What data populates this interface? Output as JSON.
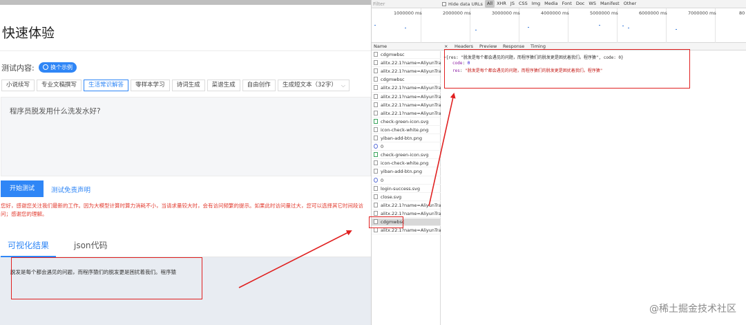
{
  "app": {
    "title": "快速体验",
    "test_label": "测试内容:",
    "example_button": "换个示例",
    "tabs": [
      "小说续写",
      "专业文稿撰写",
      "生活常识解答",
      "零样本学习",
      "诗词生成",
      "菜谱生成",
      "自由创作"
    ],
    "active_tab_index": 2,
    "select_value": "生成短文本（32字）",
    "input_text": "程序员脱发用什么洗发水好?",
    "start_button": "开始测试",
    "disclaimer_link": "测试免责声明",
    "notice": "您好，感谢您关注我们最新的工作。因为大模型计算时算力消耗不小，当请求量较大时，会有访问频繁的提示。如果此时访问量过大，您可以选择其它时间段访问；感谢您的理解。",
    "result_tabs": [
      "可视化结果",
      "json代码"
    ],
    "result_text": "脱发是每个都会遇见的问题，而程序猿们的脱发更是困扰着我们。程序猿"
  },
  "devtools": {
    "filter_placeholder": "Filter",
    "hide_data_urls": "Hide data URLs",
    "types": [
      "All",
      "XHR",
      "JS",
      "CSS",
      "Img",
      "Media",
      "Font",
      "Doc",
      "WS",
      "Manifest",
      "Other"
    ],
    "active_type": "All",
    "timeline_ticks": [
      "1000000 ms",
      "2000000 ms",
      "3000000 ms",
      "4000000 ms",
      "5000000 ms",
      "6000000 ms",
      "7000000 ms",
      "80"
    ],
    "name_header": "Name",
    "requests": [
      {
        "name": "cdgmwbsc",
        "icon": "file"
      },
      {
        "name": "alitx.22.1?name=AliyunTra...",
        "icon": "file"
      },
      {
        "name": "alitx.22.1?name=AliyunTra...",
        "icon": "file"
      },
      {
        "name": "cdgmwbsc",
        "icon": "file"
      },
      {
        "name": "alitx.22.1?name=AliyunTra...",
        "icon": "file"
      },
      {
        "name": "alitx.22.1?name=AliyunTra...",
        "icon": "file"
      },
      {
        "name": "alitx.22.1?name=AliyunTra...",
        "icon": "file"
      },
      {
        "name": "alitx.22.1?name=AliyunTra...",
        "icon": "file"
      },
      {
        "name": "check-green-icon.svg",
        "icon": "check"
      },
      {
        "name": "icon-check-white.png",
        "icon": "file"
      },
      {
        "name": "yiban-add-btn.png",
        "icon": "file"
      },
      {
        "name": "0",
        "icon": "circle"
      },
      {
        "name": "check-green-icon.svg",
        "icon": "check"
      },
      {
        "name": "icon-check-white.png",
        "icon": "file"
      },
      {
        "name": "yiban-add-btn.png",
        "icon": "file"
      },
      {
        "name": "0",
        "icon": "circle"
      },
      {
        "name": "login-success.svg",
        "icon": "arrow"
      },
      {
        "name": "close.svg",
        "icon": "file"
      },
      {
        "name": "alitx.22.1?name=AliyunTra...",
        "icon": "file"
      },
      {
        "name": "alitx.22.1?name=AliyunTra...",
        "icon": "file"
      },
      {
        "name": "cdgmwbsc",
        "icon": "file"
      },
      {
        "name": "alitx.22.1?name=AliyunTra...",
        "icon": "file"
      }
    ],
    "selected_request_index": 20,
    "detail_tabs": [
      "×",
      "Headers",
      "Preview",
      "Response",
      "Timing"
    ],
    "response": {
      "summary": "{res: \"脱发是每个都会遇见的问题，而程序猿们的脱发更是困扰着我们。程序猿\", code: 0}",
      "code_key": "code",
      "code_value": "0",
      "res_key": "res",
      "res_value": "\"脱发是每个都会遇见的问题，而程序猿们的脱发更是困扰着我们。程序猿\""
    },
    "watermark": "@稀土掘金技术社区"
  }
}
